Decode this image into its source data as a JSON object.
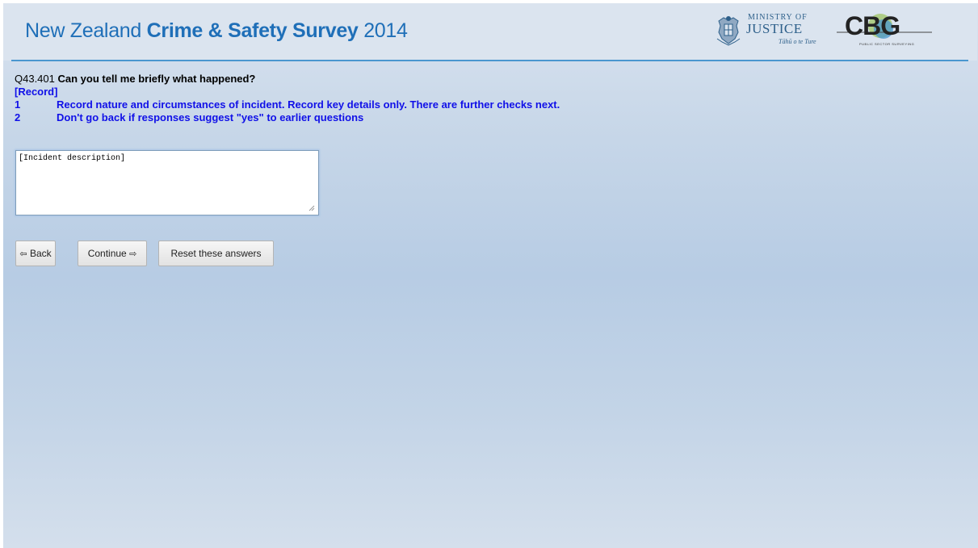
{
  "header": {
    "title_part1": "New Zealand ",
    "title_bold": "Crime & Safety Survey",
    "title_part2": " 2014",
    "ministry_line1": "MINISTRY OF",
    "ministry_line2": "JUSTICE",
    "ministry_tagline": "Tāhū o te Ture",
    "cbg_letters": "CBG",
    "cbg_tagline": "PUBLIC SECTOR SURVEYING"
  },
  "question": {
    "code": "Q43.401",
    "text": "Can you tell me briefly what happened?",
    "record_label": "[Record]",
    "instructions": [
      {
        "num": "1",
        "text": "Record nature and circumstances of incident. Record key details only. There are further checks next."
      },
      {
        "num": "2",
        "text": "Don't go back if responses suggest \"yes\" to earlier questions"
      }
    ]
  },
  "answer": {
    "value": "[Incident description]"
  },
  "buttons": {
    "back_arrow": "⇦",
    "back_label": "Back",
    "continue_label": "Continue",
    "continue_arrow": "⇨",
    "reset_label": "Reset these answers"
  },
  "colors": {
    "title_blue": "#1f6fb8",
    "instruction_blue": "#1010e8",
    "rule_blue": "#4a97cf"
  }
}
